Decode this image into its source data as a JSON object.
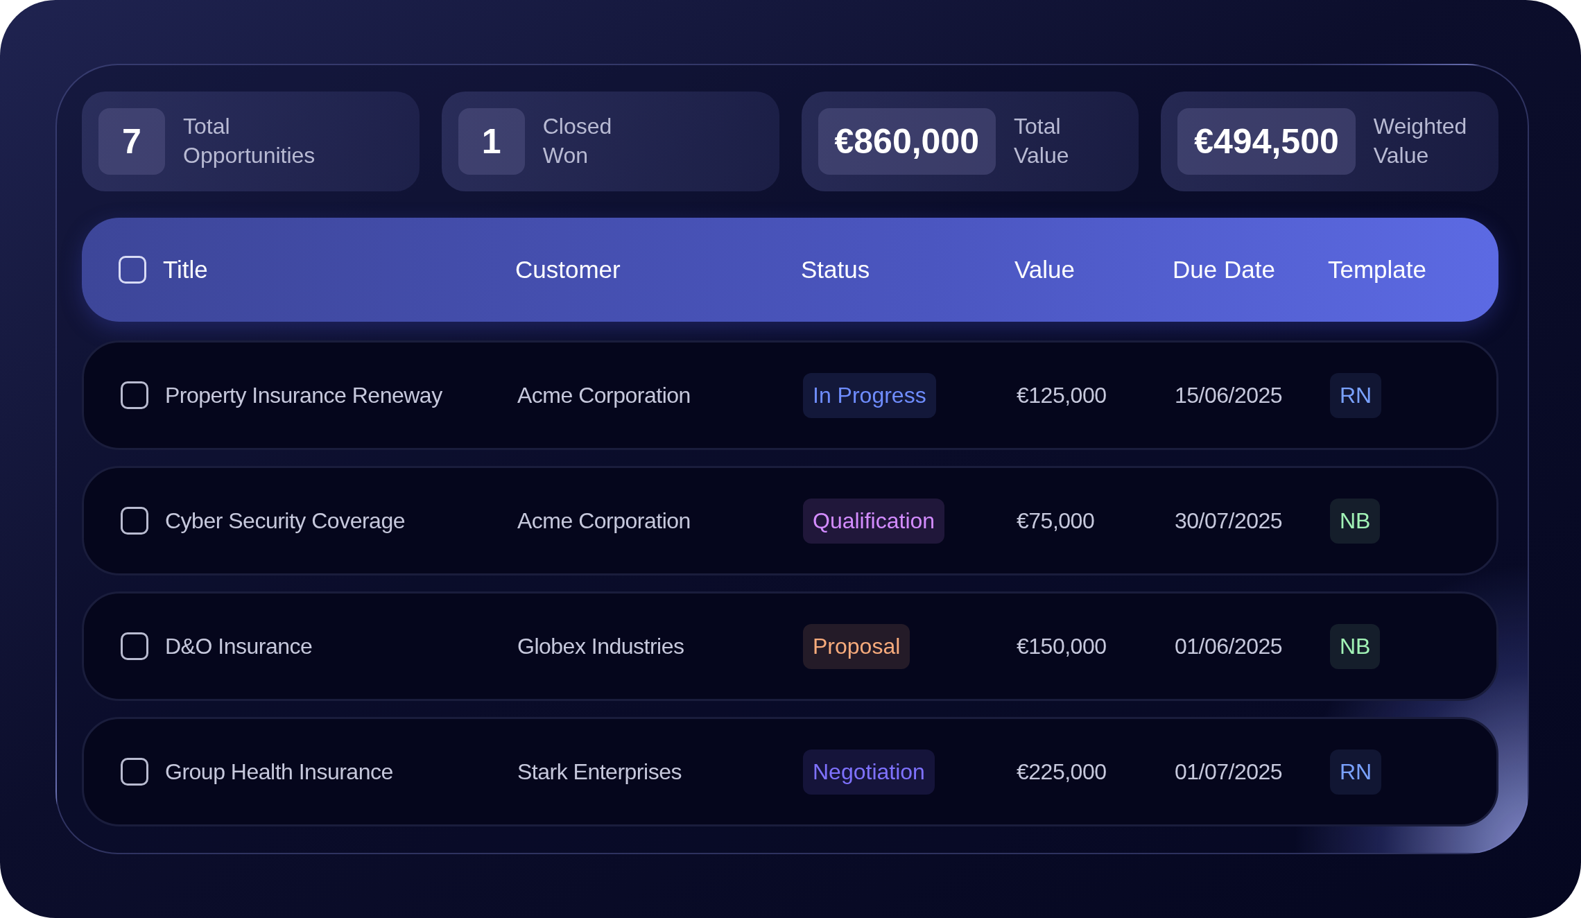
{
  "stats": [
    {
      "value": "7",
      "label": "Total Opportunities"
    },
    {
      "value": "1",
      "label": "Closed Won"
    },
    {
      "value": "€860,000",
      "label": "Total Value"
    },
    {
      "value": "€494,500",
      "label": "Weighted Value"
    }
  ],
  "table": {
    "select_all_checked": false,
    "columns": [
      "Title",
      "Customer",
      "Status",
      "Value",
      "Due Date",
      "Template"
    ],
    "rows": [
      {
        "checked": false,
        "title": "Property Insurance Reneway",
        "customer": "Acme Corporation",
        "status": {
          "label": "In Progress",
          "color": "#6f8dff"
        },
        "value": "€125,000",
        "due_date": "15/06/2025",
        "template": {
          "label": "RN",
          "color": "#7aa2ff"
        }
      },
      {
        "checked": false,
        "title": "Cyber Security Coverage",
        "customer": "Acme Corporation",
        "status": {
          "label": "Qualification",
          "color": "#d38cff"
        },
        "value": "€75,000",
        "due_date": "30/07/2025",
        "template": {
          "label": "NB",
          "color": "#a2f3b6"
        }
      },
      {
        "checked": false,
        "title": "D&O Insurance",
        "customer": "Globex Industries",
        "status": {
          "label": "Proposal",
          "color": "#f7ab7c"
        },
        "value": "€150,000",
        "due_date": "01/06/2025",
        "template": {
          "label": "NB",
          "color": "#a2f3b6"
        }
      },
      {
        "checked": false,
        "title": "Group Health Insurance",
        "customer": "Stark Enterprises",
        "status": {
          "label": "Negotiation",
          "color": "#7f72ff"
        },
        "value": "€225,000",
        "due_date": "01/07/2025",
        "template": {
          "label": "RN",
          "color": "#7aa2ff"
        }
      }
    ]
  }
}
